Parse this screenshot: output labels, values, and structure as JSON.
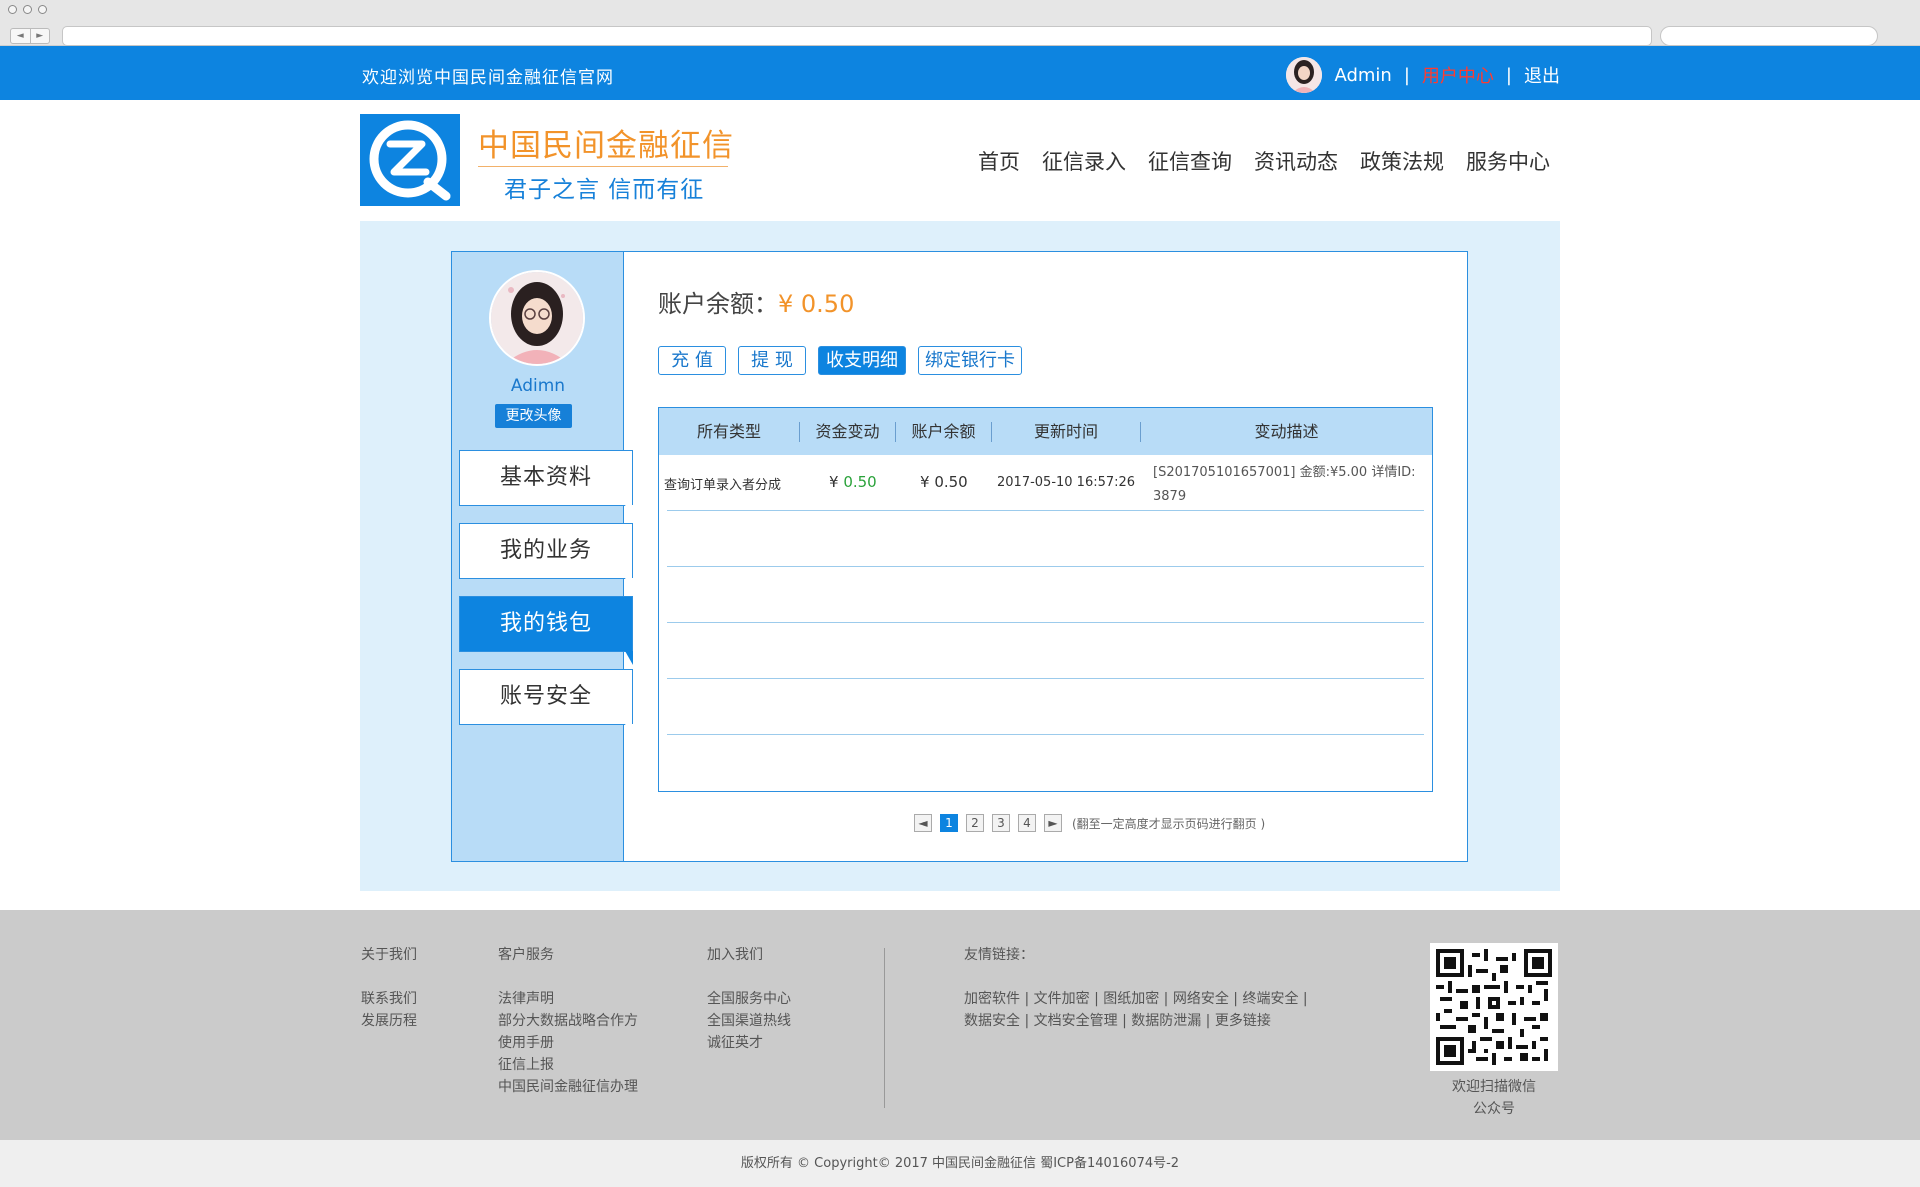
{
  "topbar": {
    "welcome": "欢迎浏览中国民间金融征信官网",
    "username": "Admin",
    "separator": "|",
    "user_center": "用户中心",
    "logout": "退出"
  },
  "header": {
    "brand_title": "中国民间金融征信",
    "brand_slogan": "君子之言 信而有征",
    "nav": [
      "首页",
      "征信录入",
      "征信查询",
      "资讯动态",
      "政策法规",
      "服务中心"
    ]
  },
  "sidebar": {
    "username": "Adimn",
    "change_avatar": "更改头像",
    "items": [
      {
        "label": "基本资料",
        "active": false
      },
      {
        "label": "我的业务",
        "active": false
      },
      {
        "label": "我的钱包",
        "active": true
      },
      {
        "label": "账号安全",
        "active": false
      }
    ]
  },
  "wallet": {
    "balance_label": "账户余额：",
    "balance_value": "¥ 0.50",
    "tabs": [
      {
        "label": "充 值",
        "active": false
      },
      {
        "label": "提 现",
        "active": false
      },
      {
        "label": "收支明细",
        "active": true
      },
      {
        "label": "绑定银行卡",
        "active": false
      }
    ],
    "table": {
      "headers": [
        "所有类型",
        "资金变动",
        "账户余额",
        "更新时间",
        "变动描述"
      ],
      "rows": [
        {
          "type": "查询订单录入者分成",
          "change_prefix": "¥",
          "change": "0.50",
          "balance_prefix": "¥",
          "balance": "0.50",
          "time": "2017-05-10 16:57:26",
          "desc_line1": "[S201705101657001] 金额:¥5.00  详情ID:",
          "desc_line2": "3879"
        }
      ]
    },
    "pager": {
      "prev": "◄",
      "pages": [
        "1",
        "2",
        "3",
        "4"
      ],
      "current": "1",
      "next": "►",
      "note": "(翻至一定高度才显示页码进行翻页 )"
    }
  },
  "footer": {
    "col1": {
      "head": "关于我们",
      "links": [
        "联系我们",
        "发展历程"
      ]
    },
    "col2": {
      "head": "客户服务",
      "links": [
        "法律声明",
        "部分大数据战略合作方",
        "使用手册",
        "征信上报",
        "中国民间金融征信办理"
      ]
    },
    "col3": {
      "head": "加入我们",
      "links": [
        "全国服务中心",
        "全国渠道热线",
        "诚征英才"
      ]
    },
    "friend": {
      "head": "友情链接：",
      "line1": "加密软件 | 文件加密 | 图纸加密 | 网络安全 | 终端安全 |",
      "line2": "数据安全 | 文档安全管理 | 数据防泄漏 | 更多链接"
    },
    "qr_caption_line1": "欢迎扫描微信",
    "qr_caption_line2": "公众号",
    "copyright": "版权所有 © Copyright© 2017 中国民间金融征信     蜀ICP备14016074号-2"
  },
  "colors": {
    "primary_blue": "#0d84e0",
    "light_blue": "#b8dcf7",
    "content_bg": "#def0fb",
    "orange": "#f2932a",
    "green": "#2aa23a",
    "red_link": "#ff3b30"
  }
}
